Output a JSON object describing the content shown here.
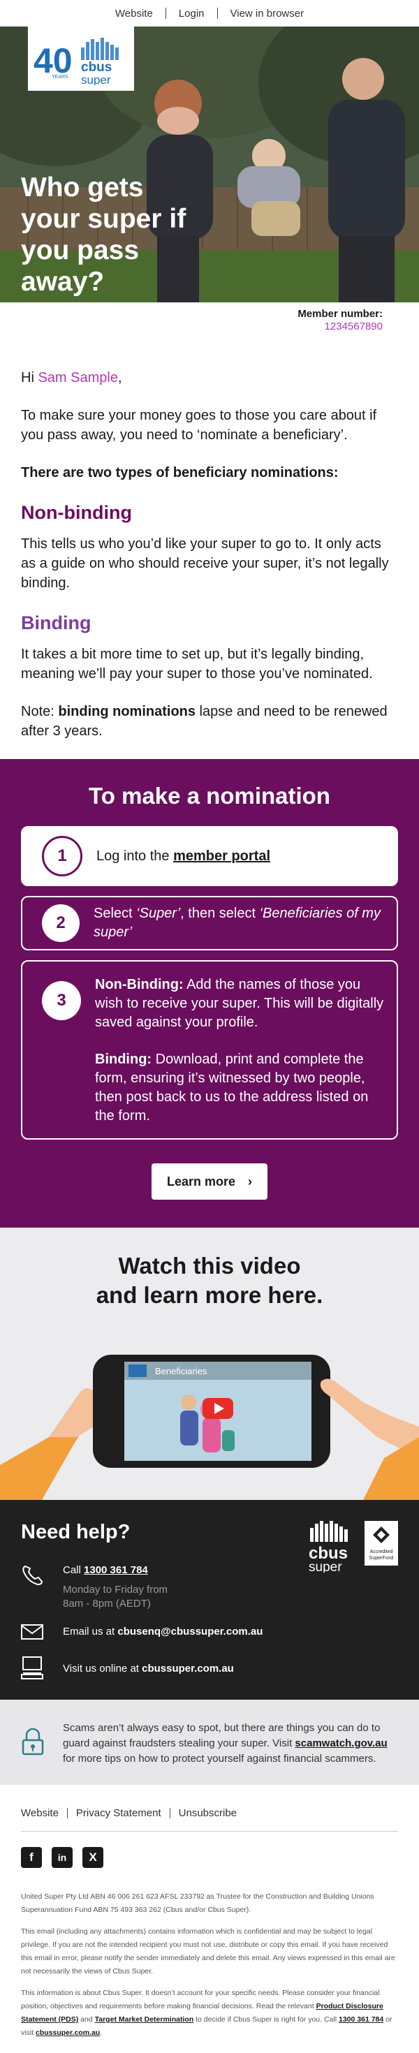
{
  "topnav": {
    "website": "Website",
    "login": "Login",
    "view_in_browser": "View in browser"
  },
  "logo": {
    "years": "40",
    "years_label": "YEARS",
    "brand": "cbus",
    "sub": "super"
  },
  "hero": {
    "title": "Who gets your super if you pass away?"
  },
  "member": {
    "label": "Member number:",
    "number": "1234567890"
  },
  "intro": {
    "greeting_pre": "Hi ",
    "name": "Sam Sample",
    "greeting_post": ",",
    "p1": "To make sure your money goes to those you care about if you pass away, you need to ‘nominate a beneficiary’.",
    "types_heading": "There are two types of beneficiary nominations:",
    "nonbinding_heading": "Non-binding",
    "nonbinding_text": "This tells us who you’d like your super to go to. It only acts as a guide on who should receive your super, it’s not legally binding.",
    "binding_heading": "Binding",
    "binding_text": "It takes a bit more time to set up, but it’s legally binding, meaning we’ll pay your super to those you’ve nominated.",
    "note_pre": "Note: ",
    "note_bold": "binding nominations",
    "note_post": " lapse and need to be renewed after 3 years."
  },
  "nomination": {
    "heading": "To make a nomination",
    "step1_num": "1",
    "step1_pre": "Log into the ",
    "step1_link": "member portal",
    "step2_num": "2",
    "step2_a": "Select ",
    "step2_b": "‘Super’",
    "step2_c": ", then select ",
    "step2_d": "‘Beneficiaries of my super’",
    "step3_num": "3",
    "step3_nb_label": "Non-Binding:",
    "step3_nb_text": " Add the names of those you wish to receive your super. This will be digitally saved against your profile.",
    "step3_b_label": "Binding:",
    "step3_b_text": " Download, print and complete the form, ensuring it’s witnessed by two people, then post back to us to the address listed on the form.",
    "button": "Learn more",
    "button_icon": "chevron-right-icon"
  },
  "video": {
    "heading_line1": "Watch this video",
    "heading_line2": "and learn more here.",
    "video_title": "Beneficiaries"
  },
  "help": {
    "heading": "Need help?",
    "call_pre": "Call ",
    "phone": "1300 361 784",
    "hours_line1": "Monday to Friday from",
    "hours_line2": "8am - 8pm (AEDT)",
    "email_pre": "Email us at ",
    "email": "cbusenq@cbussuper.com.au",
    "web_pre": "Visit us online at ",
    "web": "cbussuper.com.au",
    "accredited": "Accredited SuperFund"
  },
  "scam": {
    "text_pre": "Scams aren’t always easy to spot, but there are things you can do to guard against fraudsters stealing your super. Visit ",
    "link": "scamwatch.gov.au",
    "text_post": " for more tips on how to protect yourself against financial scammers."
  },
  "footer": {
    "website": "Website",
    "privacy": "Privacy Statement",
    "unsubscribe": "Unsubscribe",
    "social": [
      "f",
      "in",
      "X"
    ],
    "legal1": "United Super Pty Ltd ABN 46 006 261 623 AFSL 233792 as Trustee for the Construction and Building Unions Superannuation Fund ABN 75 493 363 262 (Cbus and/or Cbus Super).",
    "legal2": "This email (including any attachments) contains information which is confidential and may be subject to legal privilege. If you are not the intended recipient you must not use, distribute or copy this email. If you have received this email in error, please notify the sender immediately and delete this email. Any views expressed in this email are not necessarily the views of Cbus Super.",
    "legal3_pre": "This information is about Cbus Super. It doesn’t account for your specific needs. Please consider your financial position, objectives and requirements before making financial decisions. Read the relevant ",
    "legal3_pds": "Product Disclosure Statement (PDS)",
    "legal3_mid": " and ",
    "legal3_tmd": "Target Market Determination",
    "legal3_post": " to decide if Cbus Super is right for you. Call ",
    "legal3_phone": "1300 361 784",
    "legal3_or": " or visit ",
    "legal3_web": "cbussuper.com.au",
    "legal3_end": "."
  },
  "colors": {
    "plum": "#6b0e5e",
    "pink": "#b537b5",
    "purple": "#7a3d9e",
    "dark": "#202020"
  }
}
